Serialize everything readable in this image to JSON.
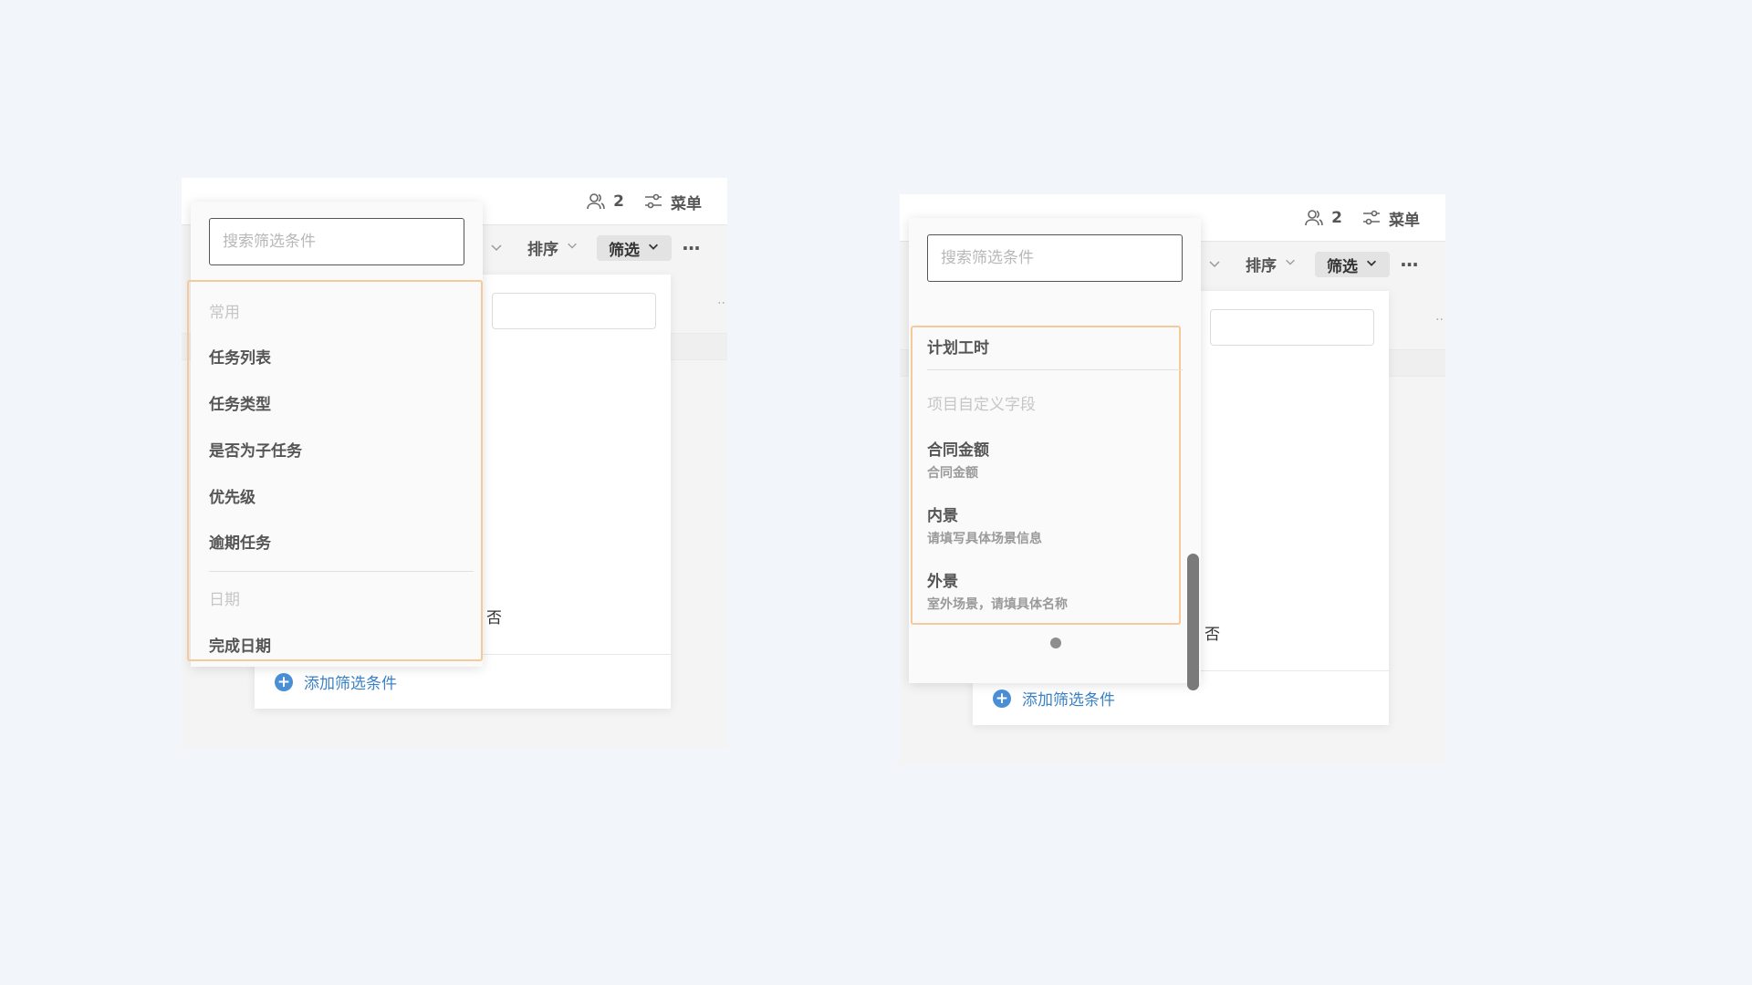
{
  "shared": {
    "member_count": "2",
    "menu_label": "菜单",
    "sort_label": "排序",
    "filter_label": "筛选",
    "more_label": "···",
    "no_label": "否",
    "add_filter_label": "添加筛选条件",
    "search_placeholder": "搜索筛选条件",
    "edge_dots": "··"
  },
  "left": {
    "options": [
      {
        "type": "group",
        "label": "常用"
      },
      {
        "type": "item",
        "label": "任务列表"
      },
      {
        "type": "item",
        "label": "任务类型"
      },
      {
        "type": "item",
        "label": "是否为子任务"
      },
      {
        "type": "item",
        "label": "优先级"
      },
      {
        "type": "item",
        "label": "逾期任务"
      },
      {
        "type": "group",
        "label": "日期"
      },
      {
        "type": "item",
        "label": "完成日期"
      }
    ]
  },
  "right": {
    "options": [
      {
        "type": "item",
        "label": "计划工时"
      },
      {
        "type": "group",
        "label": "项目自定义字段"
      },
      {
        "type": "item",
        "label": "合同金额",
        "sub": "合同金额"
      },
      {
        "type": "item",
        "label": "内景",
        "sub": "请填写具体场景信息"
      },
      {
        "type": "item",
        "label": "外景",
        "sub": "室外场景，请填具体名称"
      }
    ]
  },
  "colors": {
    "highlight": "#f5c99a",
    "accent": "#3b82c4",
    "page_bg": "#f2f6fa"
  }
}
